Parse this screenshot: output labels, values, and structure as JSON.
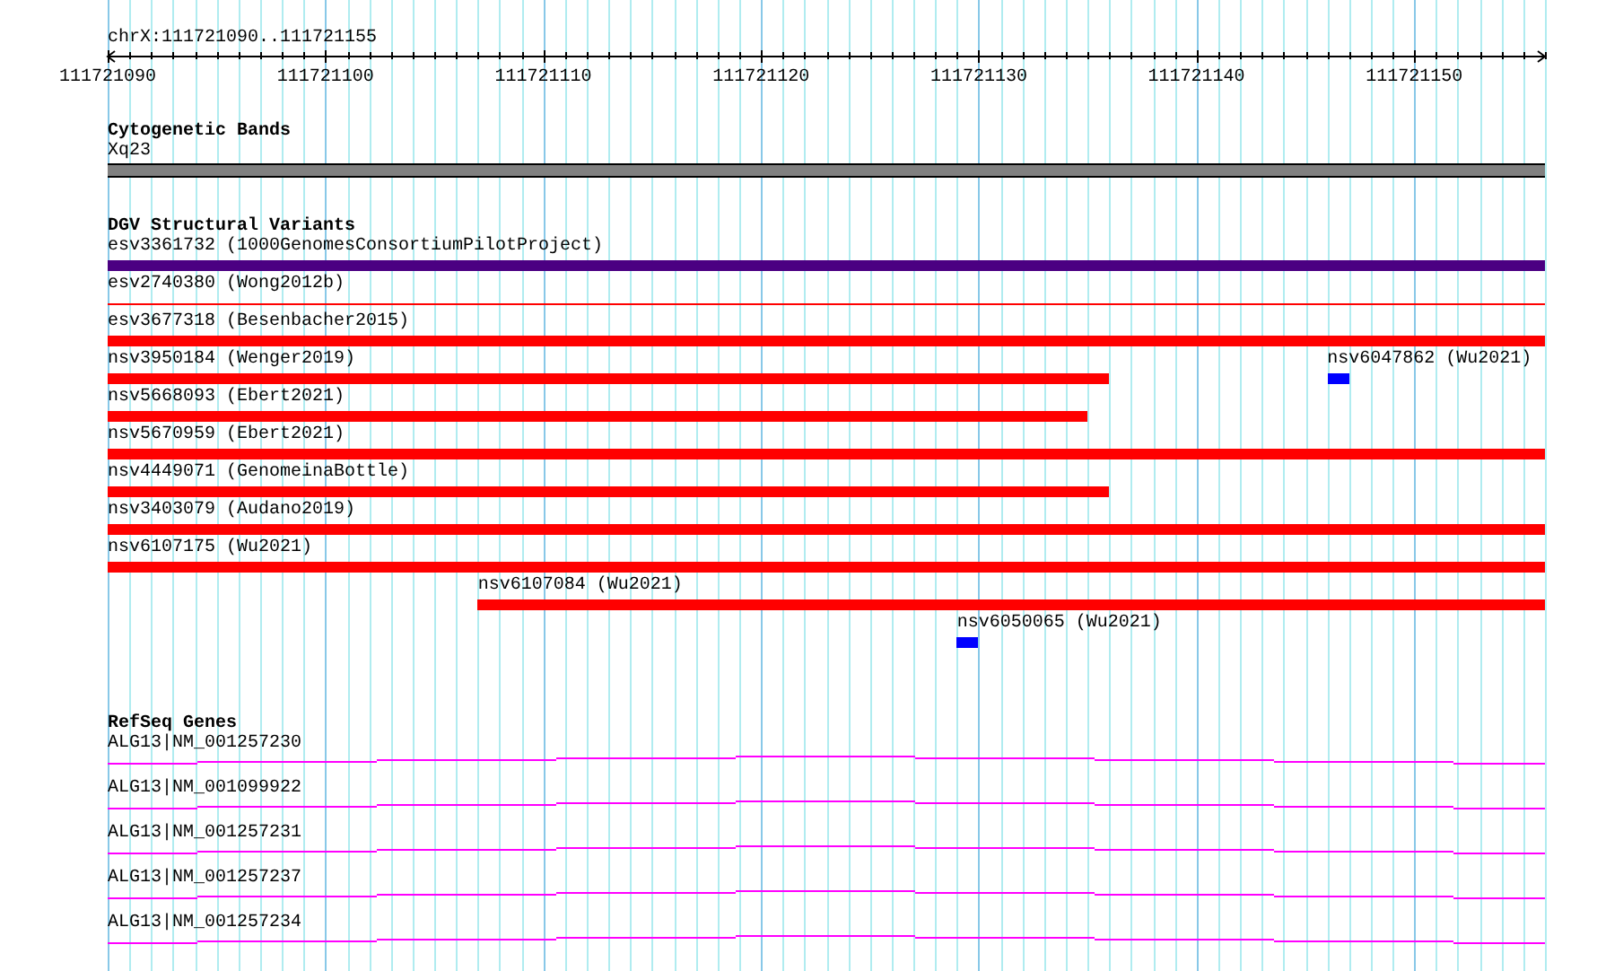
{
  "ruler": {
    "title": "chrX:111721090..111721155",
    "tick_labels": [
      "111721090",
      "111721100",
      "111721110",
      "111721120",
      "111721130",
      "111721140",
      "111721150"
    ]
  },
  "cytogenetic_bands": {
    "title": "Cytogenetic Bands",
    "band": "Xq23"
  },
  "dgv_structural_variants": {
    "title": "DGV Structural Variants",
    "rows": [
      {
        "features": [
          {
            "label": "esv3361732 (1000GenomesConsortiumPilotProject)",
            "kind": "thick",
            "color": "#4b0082"
          }
        ]
      },
      {
        "features": [
          {
            "label": "esv2740380 (Wong2012b)",
            "kind": "thin",
            "color": "#ff0000"
          }
        ]
      },
      {
        "features": [
          {
            "label": "esv3677318 (Besenbacher2015)",
            "kind": "thick",
            "color": "#ff0000"
          }
        ]
      },
      {
        "features": [
          {
            "label": "nsv3950184 (Wenger2019)",
            "kind": "thick",
            "color": "#ff0000"
          },
          {
            "label": "nsv6047862 (Wu2021)",
            "kind": "thick",
            "color": "#0000ff"
          }
        ]
      },
      {
        "features": [
          {
            "label": "nsv5668093 (Ebert2021)",
            "kind": "thick",
            "color": "#ff0000"
          }
        ]
      },
      {
        "features": [
          {
            "label": "nsv5670959 (Ebert2021)",
            "kind": "thick",
            "color": "#ff0000"
          }
        ]
      },
      {
        "features": [
          {
            "label": "nsv4449071 (GenomeinaBottle)",
            "kind": "thick",
            "color": "#ff0000"
          }
        ]
      },
      {
        "features": [
          {
            "label": "nsv3403079 (Audano2019)",
            "kind": "thick",
            "color": "#ff0000"
          }
        ]
      },
      {
        "features": [
          {
            "label": "nsv6107175 (Wu2021)",
            "kind": "thick",
            "color": "#ff0000"
          }
        ]
      },
      {
        "features": [
          {
            "label": "nsv6107084 (Wu2021)",
            "kind": "thick",
            "color": "#ff0000"
          }
        ]
      },
      {
        "features": [
          {
            "label": "nsv6050065 (Wu2021)",
            "kind": "thick",
            "color": "#0000ff"
          }
        ]
      }
    ]
  },
  "refseq_genes": {
    "title": "RefSeq Genes",
    "genes": [
      {
        "name": "ALG13|NM_001257230"
      },
      {
        "name": "ALG13|NM_001099922"
      },
      {
        "name": "ALG13|NM_001257231"
      },
      {
        "name": "ALG13|NM_001257237"
      },
      {
        "name": "ALG13|NM_001257234"
      }
    ]
  }
}
